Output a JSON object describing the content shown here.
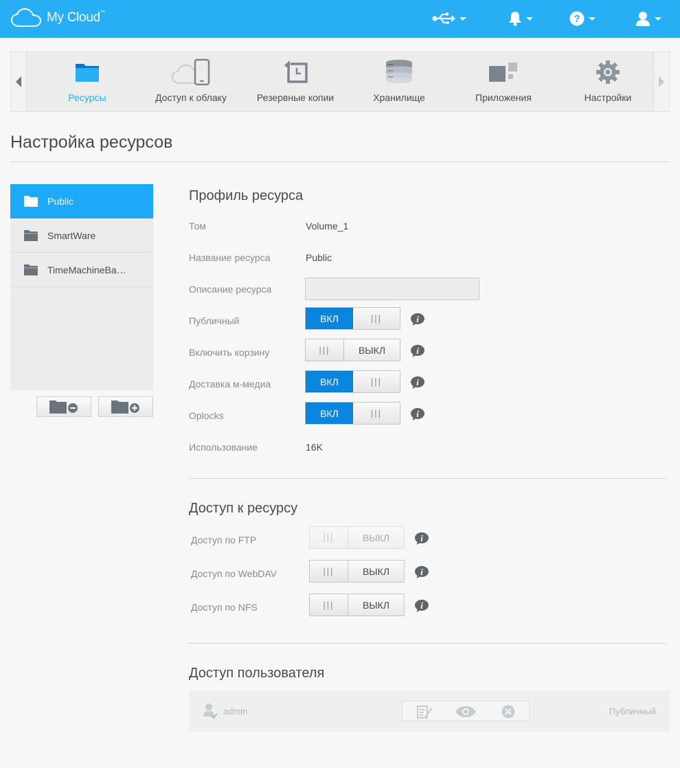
{
  "header": {
    "app_name": "My Cloud",
    "trademark": "™",
    "icons": [
      "usb-icon",
      "bell-icon",
      "help-icon",
      "user-icon"
    ]
  },
  "nav": {
    "items": [
      {
        "label": "Ресурсы",
        "icon": "folder-icon",
        "active": true
      },
      {
        "label": "Доступ к облаку",
        "icon": "cloud-device-icon",
        "active": false
      },
      {
        "label": "Резервные копии",
        "icon": "backup-icon",
        "active": false
      },
      {
        "label": "Хранилище",
        "icon": "storage-icon",
        "active": false
      },
      {
        "label": "Приложения",
        "icon": "apps-icon",
        "active": false
      },
      {
        "label": "Настройки",
        "icon": "gear-icon",
        "active": false
      }
    ]
  },
  "page": {
    "title": "Настройка ресурсов"
  },
  "shares": [
    {
      "name": "Public",
      "active": true
    },
    {
      "name": "SmartWare",
      "active": false
    },
    {
      "name": "TimeMachineBa…",
      "active": false
    }
  ],
  "profile": {
    "title": "Профиль ресурса",
    "volume_label": "Том",
    "volume_value": "Volume_1",
    "name_label": "Название ресурса",
    "name_value": "Public",
    "description_label": "Описание ресурса",
    "description_value": "",
    "public_label": "Публичный",
    "recycle_label": "Включить корзину",
    "media_label": "Доставка м-медиа",
    "oplocks_label": "Oplocks",
    "usage_label": "Использование",
    "usage_value": "16K"
  },
  "toggle_text": {
    "on": "ВКЛ",
    "off": "ВЫКЛ",
    "grip": "|||"
  },
  "toggles": {
    "public": true,
    "recycle": false,
    "media": true,
    "oplocks": true,
    "ftp": false,
    "webdav": false,
    "nfs": false
  },
  "access": {
    "title": "Доступ к ресурсу",
    "ftp_label": "Доступ по FTP",
    "webdav_label": "Доступ по WebDAV",
    "nfs_label": "Доступ по NFS"
  },
  "user_access": {
    "title": "Доступ пользователя",
    "user": "admin",
    "permission": "Публичный"
  },
  "colors": {
    "accent": "#27aef5",
    "toggle_on": "#0a86df"
  }
}
